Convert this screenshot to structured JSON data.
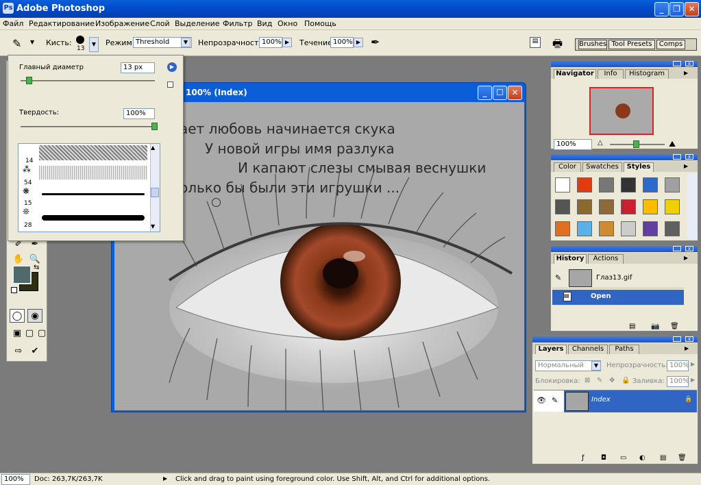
{
  "app": {
    "title": "Adobe Photoshop"
  },
  "menu": [
    "Файл",
    "Редактирование",
    "Изображение",
    "Слой",
    "Выделение",
    "Фильтр",
    "Вид",
    "Окно",
    "Помощь"
  ],
  "options": {
    "brush_label": "Кисть:",
    "brush_size": "13",
    "mode_label": "Режим:",
    "mode_value": "Threshold",
    "opacity_label": "Непрозрачность:",
    "opacity_value": "100%",
    "flow_label": "Течение:",
    "flow_value": "100%",
    "well_tabs": [
      "Brushes",
      "Tool Presets",
      "Comps"
    ]
  },
  "brush_popup": {
    "diameter_label": "Главный диаметр",
    "diameter_value": "13 px",
    "hardness_label": "Твердость:",
    "hardness_value": "100%",
    "brush_sizes": [
      "14",
      "54",
      "15",
      "28"
    ]
  },
  "document": {
    "title": "100% (Index)",
    "lyrics": [
      "ает любовь начинается скука",
      "У новой игры имя разлука",
      "И капают слезы смывая веснушки",
      "олько бы были эти игрушки ..."
    ]
  },
  "navigator": {
    "tabs": [
      "Navigator",
      "Info",
      "Histogram"
    ],
    "zoom": "100%"
  },
  "styles": {
    "tabs": [
      "Color",
      "Swatches",
      "Styles"
    ],
    "swatch_colors": [
      "#ffffff",
      "#e23b10",
      "#777777",
      "#333333",
      "#2a6acc",
      "#a0a0a0",
      "#555555",
      "#8b6a30",
      "#8e6a3a",
      "#cc2030",
      "#ffbb00",
      "#f0d000",
      "#e07020",
      "#5ab0e8",
      "#d08a30",
      "#cccccc",
      "#6040a0",
      "#606060"
    ]
  },
  "history": {
    "tabs": [
      "History",
      "Actions"
    ],
    "items": [
      "Глаз13.gif",
      "Open"
    ]
  },
  "layers": {
    "tabs": [
      "Layers",
      "Channels",
      "Paths"
    ],
    "blend_mode": "Нормальный",
    "opacity_label": "Непрозрачность:",
    "opacity_value": "100%",
    "lock_label": "Блокировка:",
    "fill_label": "Заливка:",
    "fill_value": "100%",
    "layer_name": "Index"
  },
  "status": {
    "zoom": "100%",
    "doc": "Doc: 263,7K/263,7K",
    "hint": "Click and drag to paint using foreground color.  Use Shift, Alt, and Ctrl for additional options."
  },
  "colors": {
    "foreground": "#4f6a6a",
    "background": "#2f2f10",
    "accent": "#3165c4"
  }
}
